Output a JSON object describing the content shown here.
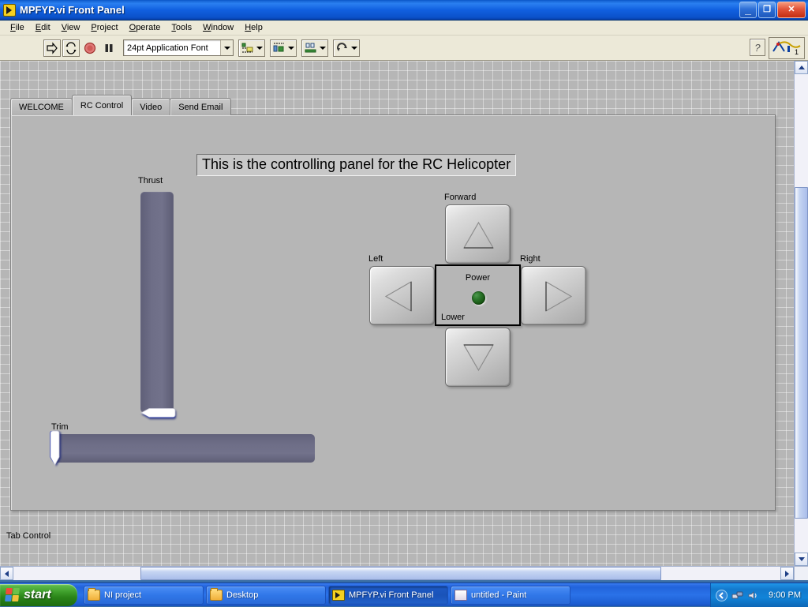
{
  "window": {
    "title": "MPFYP.vi Front Panel",
    "icon": "labview-vi-icon",
    "minimize_label": "_",
    "restore_label": "❐",
    "close_label": "✕"
  },
  "menu": {
    "items": [
      {
        "name": "file",
        "pre": "F",
        "rest": "ile"
      },
      {
        "name": "edit",
        "pre": "E",
        "rest": "dit"
      },
      {
        "name": "view",
        "pre": "V",
        "rest": "iew"
      },
      {
        "name": "project",
        "pre": "P",
        "rest": "roject"
      },
      {
        "name": "operate",
        "pre": "O",
        "rest": "perate"
      },
      {
        "name": "tools",
        "pre": "T",
        "rest": "ools"
      },
      {
        "name": "window",
        "pre": "W",
        "rest": "indow"
      },
      {
        "name": "help",
        "pre": "H",
        "rest": "elp"
      }
    ]
  },
  "toolbar": {
    "run_tooltip": "Run",
    "run_continuous_tooltip": "Run Continuously",
    "abort_tooltip": "Abort Execution",
    "pause_tooltip": "Pause",
    "font_value": "24pt Application Font",
    "align_tooltip": "Align Objects",
    "distribute_tooltip": "Distribute Objects",
    "resize_tooltip": "Resize Objects",
    "reorder_tooltip": "Reorder",
    "help_label": "?",
    "ni_logo_label": "1"
  },
  "tabs": [
    {
      "label": "WELCOME",
      "active": false
    },
    {
      "label": "RC Control",
      "active": true
    },
    {
      "label": "Video",
      "active": false
    },
    {
      "label": "Send Email",
      "active": false
    }
  ],
  "tab_control_label": "Tab Control",
  "panel": {
    "title_string": "This is the controlling panel for the RC Helicopter",
    "thrust": {
      "label": "Thrust",
      "orientation": "vertical",
      "value": 0,
      "min": 0,
      "max": 100
    },
    "trim": {
      "label": "Trim",
      "orientation": "horizontal",
      "value": 0,
      "min": 0,
      "max": 100
    },
    "dpad": {
      "forward_label": "Forward",
      "left_label": "Left",
      "right_label": "Right",
      "lower_label": "Lower"
    },
    "power": {
      "label": "Power",
      "state": "off",
      "led_color": "#1d5f18"
    }
  },
  "scrollbars": {
    "vertical_up": "▲",
    "vertical_down": "▼",
    "horizontal_left": "◀",
    "horizontal_right": "▶"
  },
  "taskbar": {
    "start_label": "start",
    "buttons": [
      {
        "label": "NI project",
        "icon": "folder-icon",
        "active": false
      },
      {
        "label": "Desktop",
        "icon": "folder-icon",
        "active": false
      },
      {
        "label": "MPFYP.vi Front Panel",
        "icon": "labview-vi-icon",
        "active": true
      },
      {
        "label": "untitled - Paint",
        "icon": "paint-icon",
        "active": false
      }
    ],
    "clock": "9:00 PM"
  },
  "colors": {
    "panel_gray": "#b6b6b6",
    "slider_track": "#6a6a82",
    "title_bar_blue": "#1160e0",
    "taskbar_blue": "#2264db",
    "start_green": "#3ea02b",
    "led_green": "#1d5f18"
  }
}
